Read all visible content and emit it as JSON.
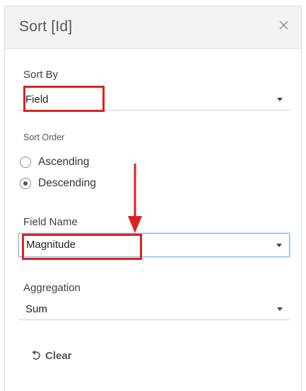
{
  "dialog": {
    "title": "Sort [Id]",
    "close_icon": "close-icon"
  },
  "sort_by": {
    "label": "Sort By",
    "value": "Field"
  },
  "sort_order": {
    "label": "Sort Order",
    "options": [
      {
        "label": "Ascending",
        "selected": false
      },
      {
        "label": "Descending",
        "selected": true
      }
    ]
  },
  "field_name": {
    "label": "Field Name",
    "value": "Magnitude"
  },
  "aggregation": {
    "label": "Aggregation",
    "value": "Sum"
  },
  "clear_button": {
    "label": "Clear",
    "icon": "undo-icon"
  },
  "annotation_colors": {
    "highlight": "#e02020",
    "arrow": "#e02020",
    "focus": "#7fb2e5"
  }
}
